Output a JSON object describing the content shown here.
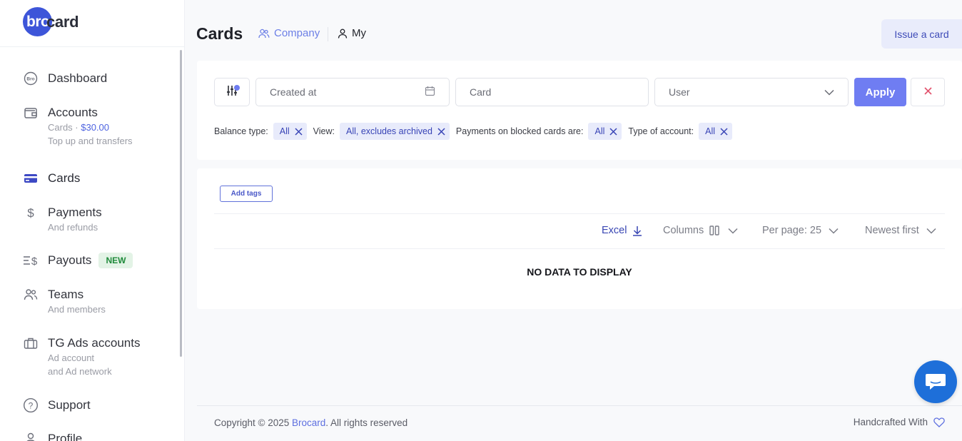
{
  "brand": {
    "logo_part1": "bro",
    "logo_part2": "card"
  },
  "sidebar": {
    "items": [
      {
        "label": "Dashboard",
        "icon": "bro-icon"
      },
      {
        "label": "Accounts",
        "sub_prefix": "Cards · ",
        "sub_amount": "$30.00",
        "sub2": "Top up and transfers",
        "icon": "wallet-icon"
      },
      {
        "label": "Cards",
        "icon": "credit-card-icon",
        "active": true
      },
      {
        "label": "Payments",
        "sub": "And refunds",
        "icon": "dollar-icon"
      },
      {
        "label": "Payouts",
        "badge": "NEW",
        "icon": "payouts-icon"
      },
      {
        "label": "Teams",
        "sub": "And members",
        "icon": "users-icon"
      },
      {
        "label": "TG Ads accounts",
        "sub": "Ad account",
        "sub2": "and Ad network",
        "icon": "briefcase-icon"
      },
      {
        "label": "Support",
        "icon": "help-icon"
      },
      {
        "label": "Profile",
        "icon": "user-icon"
      }
    ]
  },
  "header": {
    "title": "Cards",
    "tab_company": "Company",
    "tab_my": "My",
    "issue_button": "Issue a card"
  },
  "filters": {
    "created_placeholder": "Created at",
    "card_placeholder": "Card",
    "user_placeholder": "User",
    "apply": "Apply",
    "chips": [
      {
        "label": "Balance type:",
        "value": "All"
      },
      {
        "label": "View:",
        "value": "All, excludes archived"
      },
      {
        "label": "Payments on blocked cards are:",
        "value": "All"
      },
      {
        "label": "Type of account:",
        "value": "All"
      }
    ]
  },
  "table": {
    "add_tags": "Add tags",
    "excel": "Excel",
    "columns": "Columns",
    "per_page": "Per page: 25",
    "sort": "Newest first",
    "empty": "NO DATA TO DISPLAY"
  },
  "footer": {
    "copyright_prefix": "Copyright © 2025 ",
    "copyright_brand": "Brocard",
    "copyright_suffix": ". All rights reserved",
    "handcrafted": "Handcrafted With"
  },
  "colors": {
    "accent": "#6f7df2",
    "brand_blue": "#3d55d9",
    "chat": "#1e6fd9"
  }
}
